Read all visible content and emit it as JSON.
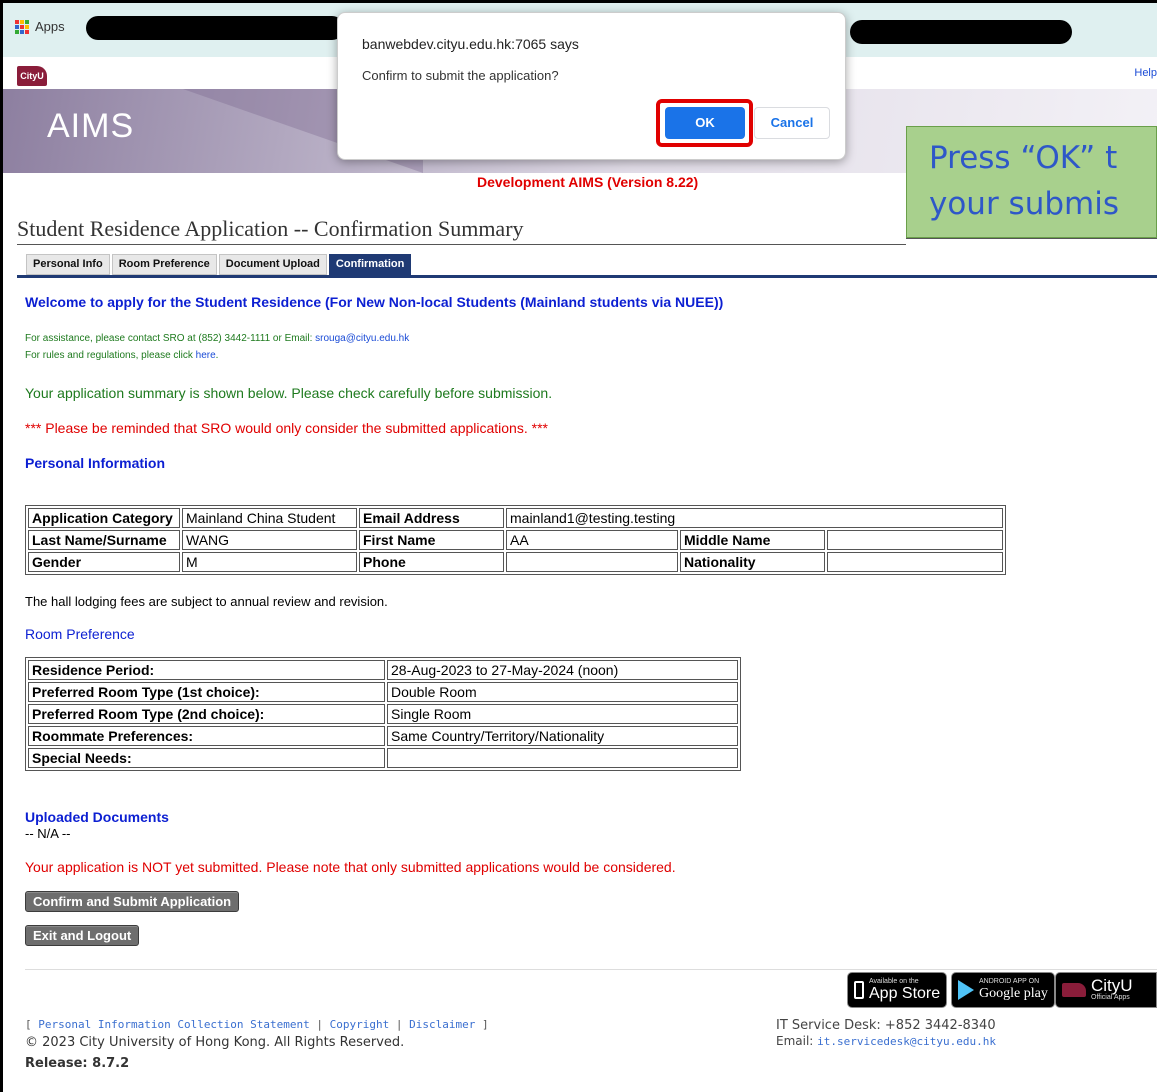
{
  "browser": {
    "apps_label": "Apps"
  },
  "header": {
    "logo_text": "CityU",
    "help_label": "Help",
    "aims_label": "AIMS",
    "dev_version": "Development AIMS (Version 8.22)"
  },
  "callout": {
    "line1": "Press “OK” t",
    "line2": "your submis"
  },
  "page": {
    "title": "Student Residence Application -- Confirmation Summary"
  },
  "tabs": [
    {
      "label": "Personal Info",
      "active": false
    },
    {
      "label": "Room Preference",
      "active": false
    },
    {
      "label": "Document Upload",
      "active": false
    },
    {
      "label": "Confirmation",
      "active": true
    }
  ],
  "intro": {
    "welcome": "Welcome to apply for the Student Residence (For New Non-local Students (Mainland students via NUEE))",
    "assist_prefix": "For assistance, please contact SRO at (852) 3442-1111 or Email: ",
    "assist_email": "srouga@cityu.edu.hk",
    "rules_prefix": "For rules and regulations, please click ",
    "rules_link": "here",
    "rules_suffix": ".",
    "summary_note": "Your application summary is shown below. Please check carefully before submission.",
    "reminder": "*** Please be reminded that SRO would only consider the submitted applications. ***"
  },
  "personal": {
    "heading": "Personal Information",
    "rows": [
      [
        "Application Category",
        "Mainland China Student",
        "Email Address",
        "mainland1@testing.testing"
      ],
      [
        "Last Name/Surname",
        "WANG",
        "First Name",
        "AA",
        "Middle Name",
        ""
      ],
      [
        "Gender",
        "M",
        "Phone",
        "",
        "Nationality",
        ""
      ]
    ]
  },
  "fees_note": "The hall lodging fees are subject to annual review and revision.",
  "room": {
    "heading": "Room Preference",
    "rows": [
      [
        "Residence Period:",
        "28-Aug-2023 to 27-May-2024 (noon)"
      ],
      [
        "Preferred Room Type (1st choice):",
        "Double Room"
      ],
      [
        "Preferred Room Type (2nd choice):",
        "Single Room"
      ],
      [
        "Roommate Preferences:",
        "Same Country/Territory/Nationality"
      ],
      [
        "Special Needs:",
        ""
      ]
    ]
  },
  "documents": {
    "heading": "Uploaded Documents",
    "value": "-- N/A --"
  },
  "not_submitted": "Your application is NOT yet submitted. Please note that only submitted applications would be considered.",
  "buttons": {
    "confirm": "Confirm and Submit Application",
    "exit": "Exit and Logout"
  },
  "footer": {
    "pics": "Personal Information Collection Statement",
    "copyright_link": "Copyright",
    "disclaimer": "Disclaimer",
    "copyright": "© 2023 City University of Hong Kong. All Rights Reserved.",
    "release": "Release: 8.7.2",
    "it_desk": "IT Service Desk: +852 3442-8340",
    "it_email_prefix": "Email: ",
    "it_email": "it.servicedesk@cityu.edu.hk",
    "appstore_small": "Available on the",
    "appstore_big": "App Store",
    "gplay_small": "ANDROID APP ON",
    "gplay_big": "Google play",
    "cityu_big": "CityU",
    "cityu_small": "Official Apps"
  },
  "dialog": {
    "title": "banwebdev.cityu.edu.hk:7065 says",
    "message": "Confirm to submit the application?",
    "ok": "OK",
    "cancel": "Cancel"
  }
}
